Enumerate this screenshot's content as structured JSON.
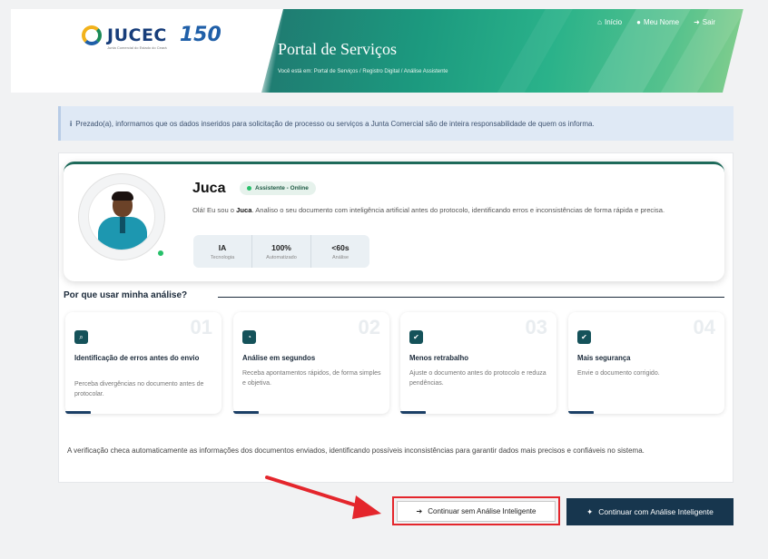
{
  "header": {
    "logo_text": "JUCEC",
    "logo_anniversary": "150",
    "logo_subtitle": "Junta Comercial do Estado do Ceará",
    "portal_title": "Portal de Serviços",
    "breadcrumb": "Você está em: Portal de Serviços / Registro Digital / Análise Assistente",
    "nav": [
      {
        "label": "Início",
        "icon": "home-icon"
      },
      {
        "label": "Meu Nome",
        "icon": "user-icon"
      },
      {
        "label": "Sair",
        "icon": "sign-out-icon"
      }
    ]
  },
  "notice": {
    "icon": "info-icon",
    "text": "Prezado(a), informamos que os dados inseridos para solicitação de processo ou serviços a Junta Comercial são de inteira responsabilidade de quem os informa."
  },
  "assistant": {
    "name": "Juca",
    "status": "Assistente - Online",
    "desc_pre": "Olá! Eu sou o ",
    "desc_name": "Juca",
    "desc_post": ". Analiso o seu documento com inteligência artificial antes do protocolo, identificando erros e inconsistências de forma rápida e precisa.",
    "stats": [
      {
        "value": "IA",
        "label": "Tecnologia"
      },
      {
        "value": "100%",
        "label": "Automatizado"
      },
      {
        "value": "<60s",
        "label": "Análise"
      }
    ]
  },
  "why": {
    "heading": "Por que usar minha análise?",
    "cards": [
      {
        "num": "01",
        "icon": "document-search-icon",
        "title": "Identificação de erros antes do envio",
        "desc": "Perceba divergências no documento antes de protocolar."
      },
      {
        "num": "02",
        "icon": "timer-icon",
        "title": "Análise em segundos",
        "desc": "Receba apontamentos rápidos, de forma simples e objetiva."
      },
      {
        "num": "03",
        "icon": "check-circle-icon",
        "title": "Menos retrabalho",
        "desc": "Ajuste o documento antes do protocolo e reduza pendências."
      },
      {
        "num": "04",
        "icon": "shield-check-icon",
        "title": "Mais segurança",
        "desc": "Envie o documento corrigido."
      }
    ]
  },
  "footer_text": "A verificação checa automaticamente as informações dos documentos enviados, identificando possíveis inconsistências para garantir dados mais precisos e confiáveis no sistema.",
  "buttons": {
    "without_ai": "Continuar sem Análise Inteligente",
    "with_ai": "Continuar com Análise Inteligente"
  },
  "colors": {
    "primary_button": "#17364e",
    "annotation": "#e4262c",
    "online": "#27c06a"
  }
}
